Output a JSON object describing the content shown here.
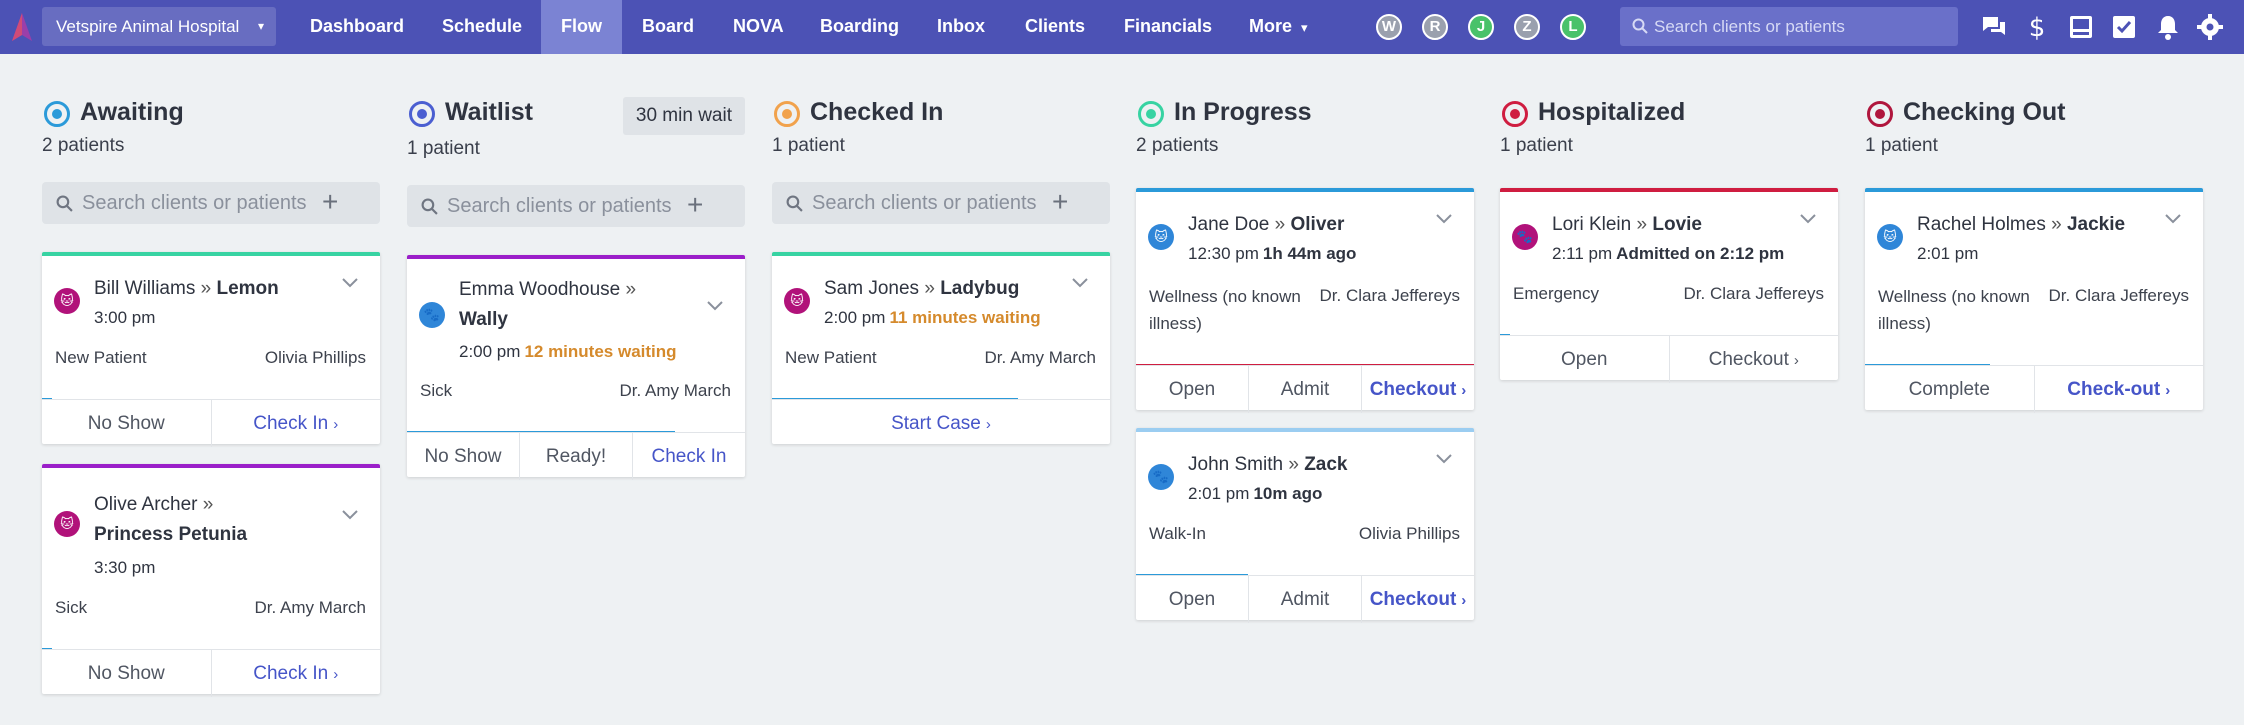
{
  "nav": {
    "hospital": "Vetspire Animal Hospital",
    "items": [
      "Dashboard",
      "Schedule",
      "Flow",
      "Board",
      "NOVA",
      "Boarding",
      "Inbox",
      "Clients",
      "Financials",
      "More"
    ],
    "active": "Flow",
    "more_caret": "▾",
    "avatars": [
      "W",
      "R",
      "J",
      "Z",
      "L"
    ],
    "search_placeholder": "Search clients or patients"
  },
  "columns": [
    {
      "title": "Awaiting",
      "count": "2 patients",
      "color": "#2b9ad9",
      "search_placeholder": "Search clients or patients",
      "cards": [
        {
          "owner": "Bill Williams",
          "patient": "Lemon",
          "time": "3:00 pm",
          "extra": "",
          "reason": "New Patient",
          "doctor": "Olivia Phillips",
          "pet": "cat",
          "actions": [
            "No Show",
            "Check In"
          ],
          "progress": 0.03
        },
        {
          "owner": "Olive Archer",
          "patient": "Princess Petunia",
          "time": "3:30 pm",
          "extra": "",
          "reason": "Sick",
          "doctor": "Dr. Amy March",
          "pet": "cat",
          "actions": [
            "No Show",
            "Check In"
          ],
          "progress": 0.03
        }
      ]
    },
    {
      "title": "Waitlist",
      "count": "1 patient",
      "color": "#4b5fd1",
      "badge": "30 min wait",
      "search_placeholder": "Search clients or patients",
      "cards": [
        {
          "owner": "Emma Woodhouse",
          "patient": "Wally",
          "time": "2:00 pm",
          "extra": "12 minutes waiting",
          "reason": "Sick",
          "doctor": "Dr. Amy March",
          "pet": "dog",
          "actions": [
            "No Show",
            "Ready!",
            "Check In"
          ],
          "progress": 0.55
        }
      ]
    },
    {
      "title": "Checked In",
      "count": "1 patient",
      "color": "#f1a24c",
      "search_placeholder": "Search clients or patients",
      "cards": [
        {
          "owner": "Sam Jones",
          "patient": "Ladybug",
          "time": "2:00 pm",
          "extra": "11 minutes waiting",
          "reason": "New Patient",
          "doctor": "Dr. Amy March",
          "pet": "cat",
          "actions": [
            "Start Case"
          ],
          "progress": 0.73
        }
      ]
    },
    {
      "title": "In Progress",
      "count": "2 patients",
      "color": "#37d3a2",
      "cards": [
        {
          "owner": "Jane Doe",
          "patient": "Oliver",
          "time": "12:30 pm",
          "extra": "1h 44m ago",
          "reason": "Wellness (no known illness)",
          "doctor": "Dr. Clara Jeffereys",
          "pet": "cat",
          "actions": [
            "Open",
            "Admit",
            "Checkout"
          ],
          "progress": 1.0
        },
        {
          "owner": "John Smith",
          "patient": "Zack",
          "time": "2:01 pm",
          "extra": "10m ago",
          "reason": "Walk-In",
          "doctor": "Olivia Phillips",
          "pet": "dog",
          "actions": [
            "Open",
            "Admit",
            "Checkout"
          ],
          "progress": 0.33
        }
      ]
    },
    {
      "title": "Hospitalized",
      "count": "1 patient",
      "color": "#cf1d40",
      "cards": [
        {
          "owner": "Lori Klein",
          "patient": "Lovie",
          "time": "2:11 pm",
          "extra": "Admitted on 2:12 pm",
          "reason": "Emergency",
          "doctor": "Dr. Clara Jeffereys",
          "pet": "dog",
          "actions": [
            "Open",
            "Checkout"
          ],
          "progress": 0.03
        }
      ]
    },
    {
      "title": "Checking Out",
      "count": "1 patient",
      "color": "#b0163d",
      "cards": [
        {
          "owner": "Rachel Holmes",
          "patient": "Jackie",
          "time": "2:01 pm",
          "extra": "",
          "reason": "Wellness (no known illness)",
          "doctor": "Dr. Clara Jeffereys",
          "pet": "cat",
          "actions": [
            "Complete",
            "Check-out"
          ],
          "progress": 0.37
        }
      ]
    }
  ]
}
